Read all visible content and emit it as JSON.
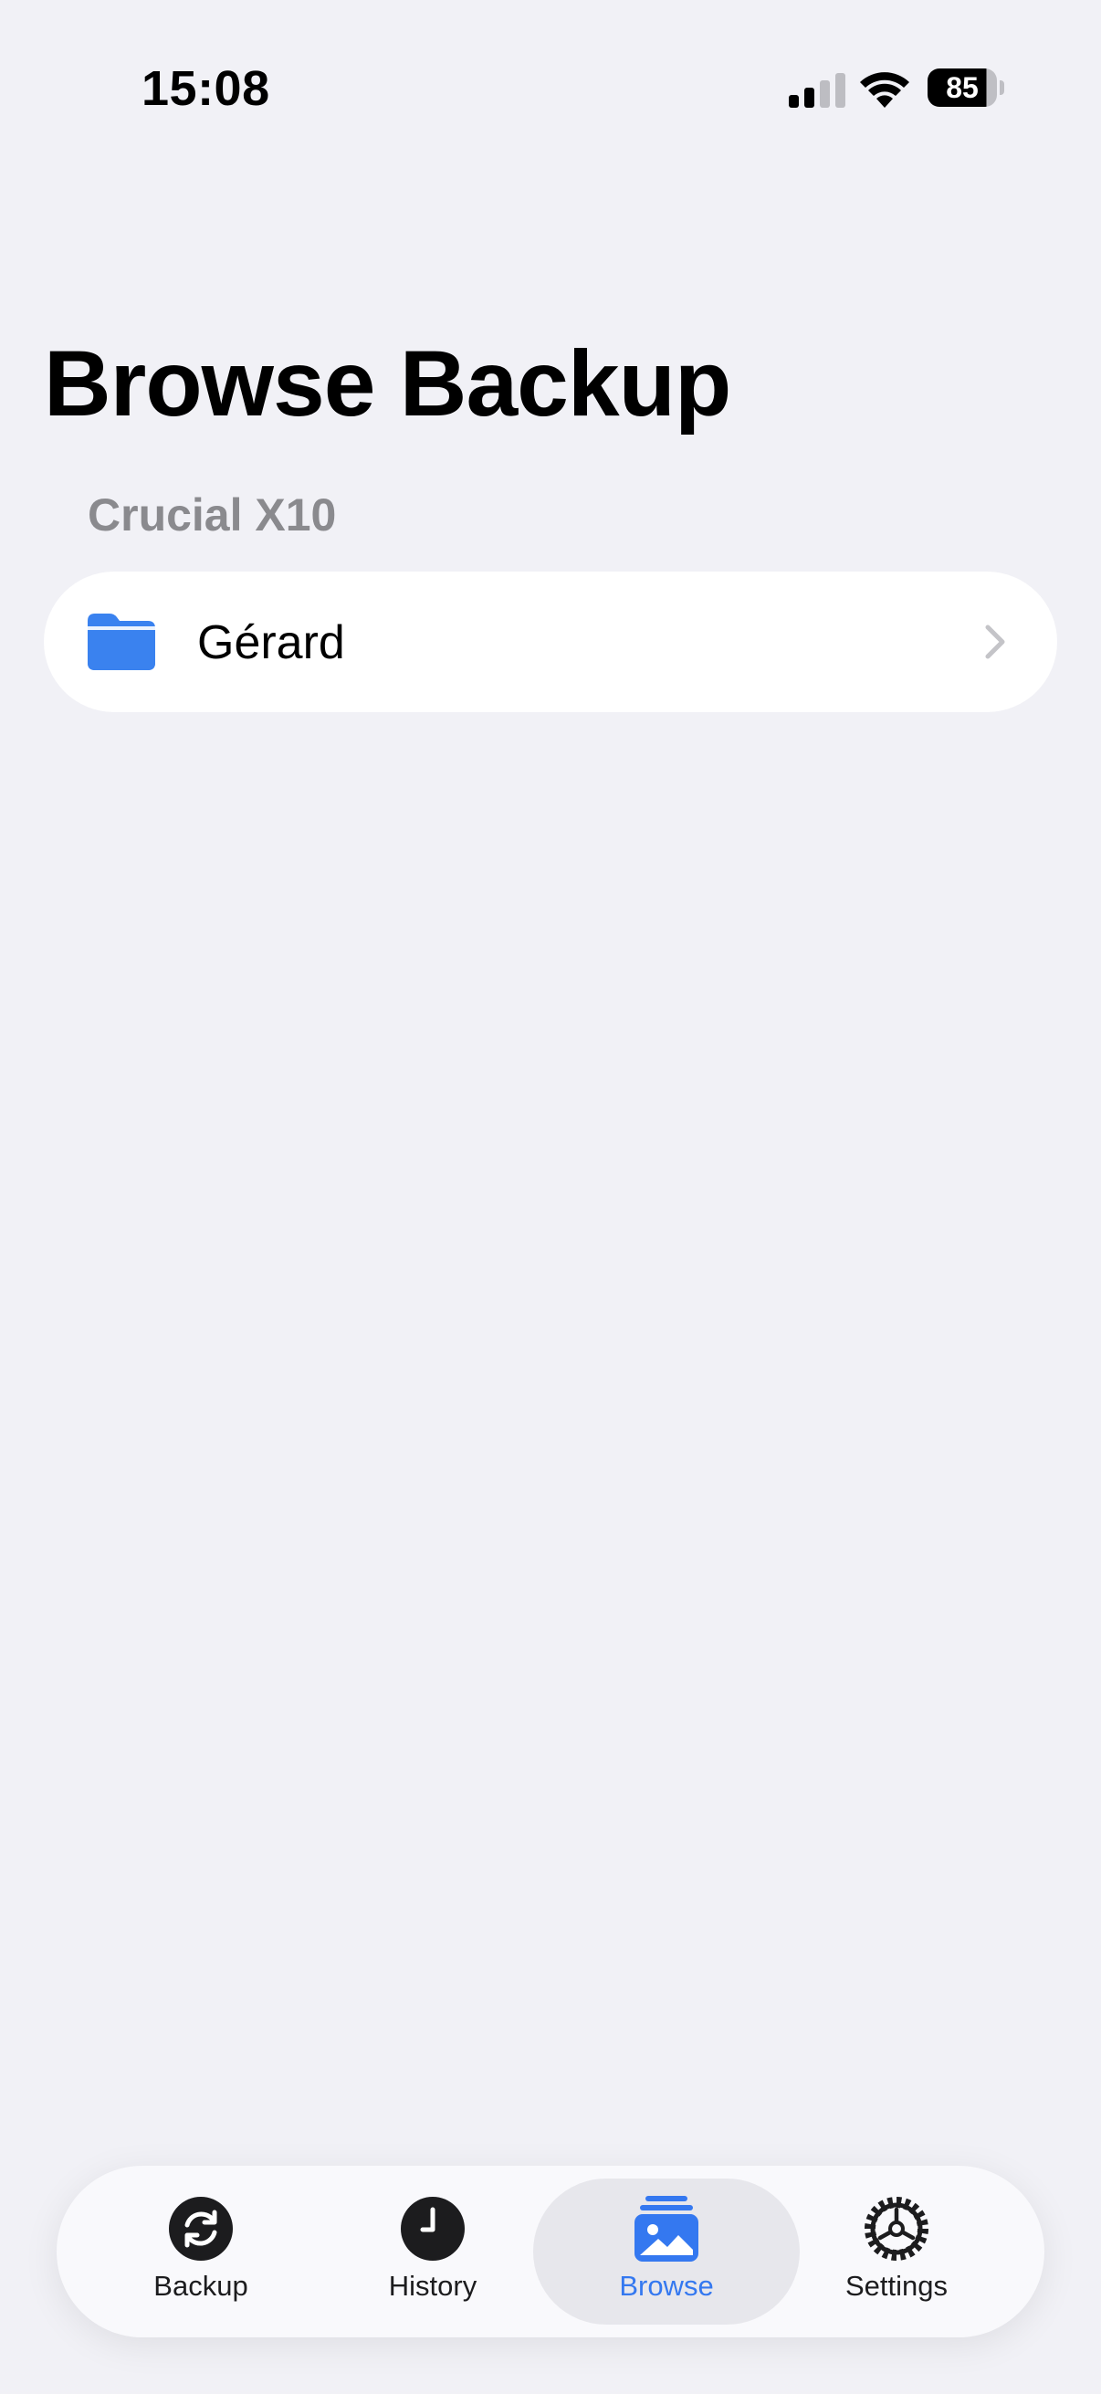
{
  "status_bar": {
    "time": "15:08",
    "battery": "85",
    "icons": [
      "cellular-signal-icon",
      "wifi-icon",
      "battery-icon"
    ]
  },
  "header": {
    "title": "Browse Backup"
  },
  "section": {
    "title": "Crucial X10",
    "items": [
      {
        "label": "Gérard",
        "icon": "folder-icon"
      }
    ]
  },
  "tab_bar": {
    "selected": "Browse",
    "accent_color": "#3478f0",
    "tabs": [
      {
        "label": "Backup",
        "icon": "sync-icon"
      },
      {
        "label": "History",
        "icon": "clock-icon"
      },
      {
        "label": "Browse",
        "icon": "photo-stack-icon"
      },
      {
        "label": "Settings",
        "icon": "gear-icon"
      }
    ]
  }
}
